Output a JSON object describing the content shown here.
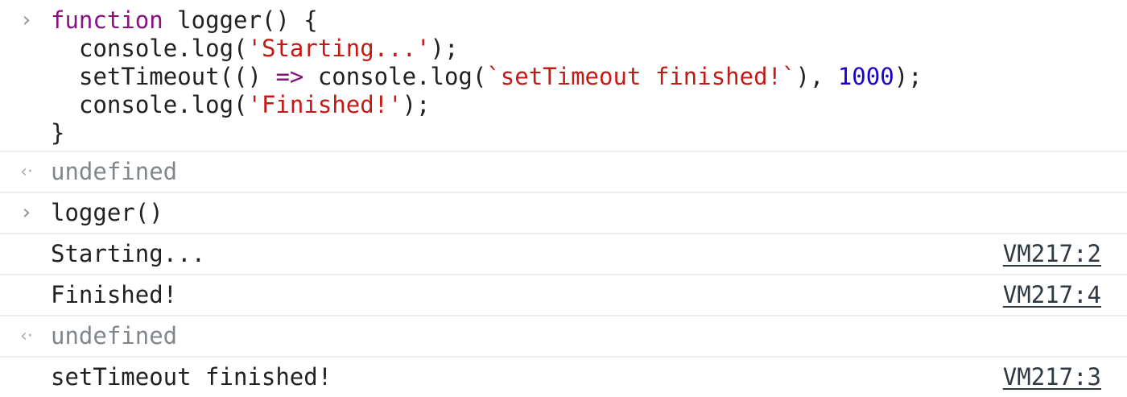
{
  "input_1": {
    "prompt_icon": "chevron-right-icon",
    "lines": {
      "l1": [
        "function",
        " logger() {"
      ],
      "l2": [
        "console.log(",
        "'Starting...'",
        ");"
      ],
      "l3": [
        "setTimeout(() ",
        "=>",
        " console.log(",
        "`setTimeout finished!`",
        "), ",
        "1000",
        ");"
      ],
      "l4": [
        "console.log(",
        "'Finished!'",
        ");"
      ],
      "l5": "}"
    }
  },
  "result_1": {
    "icon": "return-arrow-icon",
    "text": "undefined"
  },
  "input_2": {
    "prompt_icon": "chevron-right-icon",
    "text": "logger()"
  },
  "log_1": {
    "text": "Starting...",
    "source": "VM217:2"
  },
  "log_2": {
    "text": "Finished!",
    "source": "VM217:4"
  },
  "result_2": {
    "icon": "return-arrow-icon",
    "text": "undefined"
  },
  "log_3": {
    "text": "setTimeout finished!",
    "source": "VM217:3"
  },
  "colors": {
    "keyword": "#881280",
    "string": "#c41a16",
    "number": "#1c00cf",
    "link": "#303942",
    "undefined": "#80868b"
  }
}
